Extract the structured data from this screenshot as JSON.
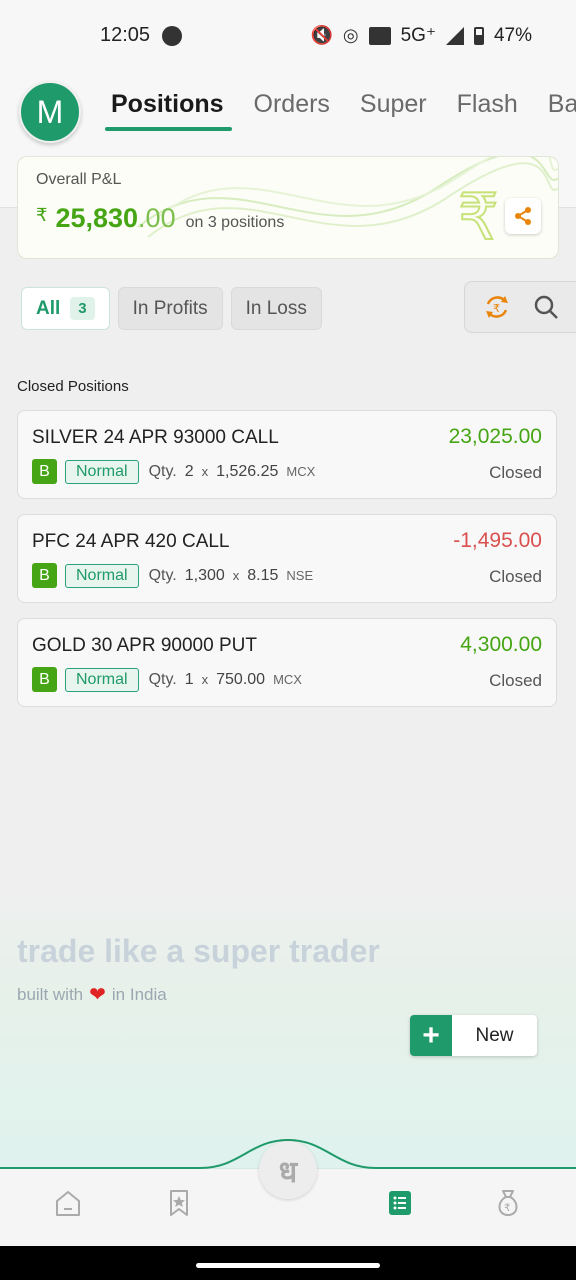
{
  "status_bar": {
    "time": "12:05",
    "network": "5G⁺",
    "battery": "47%"
  },
  "header": {
    "avatar_initial": "M",
    "tabs": [
      "Positions",
      "Orders",
      "Super",
      "Flash",
      "Bas"
    ]
  },
  "pnl": {
    "label": "Overall P&L",
    "currency": "₹",
    "value_int": "25,830",
    "value_dec": ".00",
    "positions_text": "on 3 positions"
  },
  "filters": {
    "all_label": "All",
    "all_count": "3",
    "profits_label": "In Profits",
    "loss_label": "In Loss"
  },
  "section": {
    "title": "Closed Positions"
  },
  "positions": [
    {
      "symbol": "SILVER 24 APR 93000 CALL",
      "pnl": "23,025.00",
      "side": "B",
      "product": "Normal",
      "qty_label": "Qty.",
      "qty": "2",
      "x": "x",
      "price": "1,526.25",
      "exchange": "MCX",
      "status": "Closed"
    },
    {
      "symbol": "PFC 24 APR 420 CALL",
      "pnl": "-1,495.00",
      "side": "B",
      "product": "Normal",
      "qty_label": "Qty.",
      "qty": "1,300",
      "x": "x",
      "price": "8.15",
      "exchange": "NSE",
      "status": "Closed"
    },
    {
      "symbol": "GOLD 30 APR 90000 PUT",
      "pnl": "4,300.00",
      "side": "B",
      "product": "Normal",
      "qty_label": "Qty.",
      "qty": "1",
      "x": "x",
      "price": "750.00",
      "exchange": "MCX",
      "status": "Closed"
    }
  ],
  "footer": {
    "tagline": "trade like a super trader",
    "built_with": "built with",
    "in_india": "in India",
    "new_label": "New",
    "center_glyph": "ध"
  },
  "colors": {
    "accent": "#1f9a6a",
    "gain": "#46a514",
    "loss": "#d9504e"
  }
}
